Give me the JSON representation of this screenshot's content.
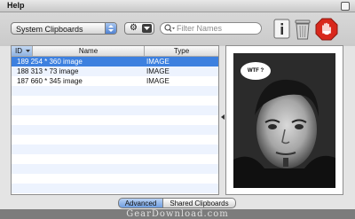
{
  "titlebar": {
    "menu_label": "Help"
  },
  "toolbar": {
    "clipboard_select": {
      "selected": "System Clipboards"
    },
    "action_menu": {
      "icon": "gear-icon"
    },
    "search": {
      "placeholder": "Filter Names",
      "value": ""
    },
    "icons": [
      "info-icon",
      "trash-icon",
      "stop-hand-icon"
    ]
  },
  "list": {
    "columns": {
      "id": "ID",
      "name": "Name",
      "type": "Type"
    },
    "rows": [
      {
        "name": "189 254 * 360 image",
        "type": "IMAGE",
        "selected": true
      },
      {
        "name": "188 313 * 73 image",
        "type": "IMAGE",
        "selected": false
      },
      {
        "name": "187 660 * 345 image",
        "type": "IMAGE",
        "selected": false
      }
    ]
  },
  "preview": {
    "bubble_text": "WTF ?"
  },
  "bottom_tabs": [
    {
      "label": "Advanced",
      "active": true
    },
    {
      "label": "Shared Clipboards",
      "active": false
    }
  ],
  "watermark": "GearDownload.com",
  "colors": {
    "selection": "#3d80df",
    "stop": "#d8281c"
  }
}
